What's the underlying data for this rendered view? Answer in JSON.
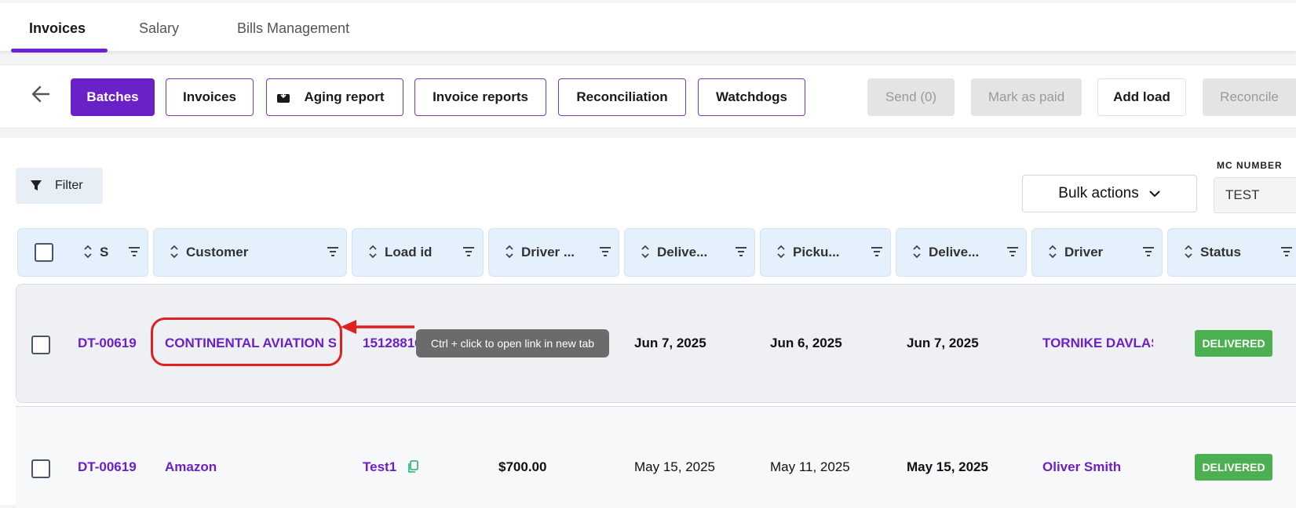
{
  "tabs": [
    {
      "label": "Invoices",
      "active": true
    },
    {
      "label": "Salary",
      "active": false
    },
    {
      "label": "Bills Management",
      "active": false
    }
  ],
  "toolbar": {
    "batches": "Batches",
    "invoices": "Invoices",
    "aging_report": "Aging report",
    "invoice_reports": "Invoice reports",
    "reconciliation": "Reconciliation",
    "watchdogs": "Watchdogs",
    "send": "Send (0)",
    "mark_as_paid": "Mark as paid",
    "add_load": "Add load",
    "reconcile": "Reconcile"
  },
  "filter": {
    "label": "Filter"
  },
  "bulk_actions": {
    "label": "Bulk actions"
  },
  "mc_number": {
    "label": "MC NUMBER",
    "value": "TEST"
  },
  "columns": [
    "S",
    "Customer",
    "Load id",
    "Driver ...",
    "Delive...",
    "Picku...",
    "Delive...",
    "Driver",
    "Status"
  ],
  "rows": [
    {
      "id": "DT-00619",
      "customer": "CONTINENTAL AVIATION SA",
      "load_id": "15128816",
      "driver_pay": "",
      "delivery_date": "Jun 7, 2025",
      "pickup_date": "Jun 6, 2025",
      "delivered": "Jun 7, 2025",
      "driver": "TORNIKE DAVLASHELIDZE",
      "status": "DELIVERED"
    },
    {
      "id": "DT-00619",
      "customer": "Amazon",
      "load_id": "Test1",
      "driver_pay": "$700.00",
      "delivery_date": "May 15, 2025",
      "pickup_date": "May 11, 2025",
      "delivered": "May 15, 2025",
      "driver": "Oliver Smith",
      "status": "DELIVERED"
    }
  ],
  "tooltip": {
    "text": "Ctrl + click to open link in new tab"
  },
  "colors": {
    "accent": "#6b21c8",
    "status_delivered": "#4caf50",
    "annotation": "#e02020",
    "header_bg": "#e4f0fb"
  }
}
